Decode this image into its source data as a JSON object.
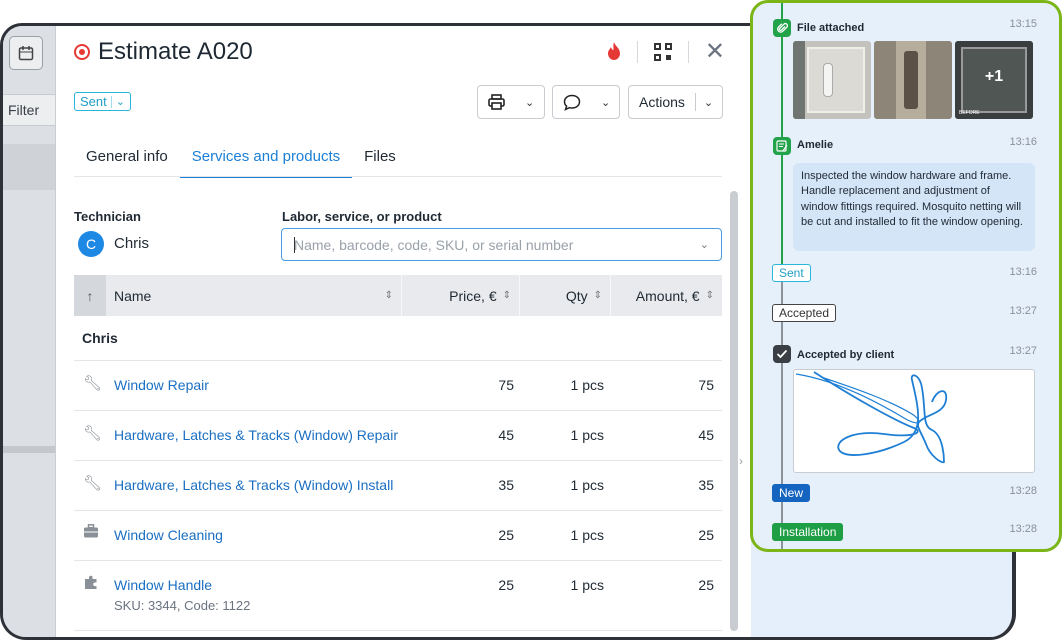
{
  "background": {
    "filter_label": "Filter"
  },
  "modal": {
    "title": "Estimate A020",
    "status": "Sent",
    "actions_label": "Actions",
    "tabs": [
      "General info",
      "Services and products",
      "Files"
    ],
    "technician_label": "Technician",
    "technician_initial": "C",
    "technician_name": "Chris",
    "search_label": "Labor, service, or product",
    "search_placeholder": "Name, barcode, code, SKU, or serial number",
    "columns": {
      "name": "Name",
      "price": "Price, €",
      "qty": "Qty",
      "amount": "Amount, €"
    },
    "group": "Chris",
    "rows": [
      {
        "icon": "wrench-icon",
        "name": "Window Repair",
        "price": "75",
        "qty": "1 pcs",
        "amount": "75",
        "sub": ""
      },
      {
        "icon": "wrench-icon",
        "name": "Hardware, Latches & Tracks (Window) Repair",
        "price": "45",
        "qty": "1 pcs",
        "amount": "45",
        "sub": ""
      },
      {
        "icon": "wrench-icon",
        "name": "Hardware, Latches & Tracks (Window) Install",
        "price": "35",
        "qty": "1 pcs",
        "amount": "35",
        "sub": ""
      },
      {
        "icon": "briefcase-icon",
        "name": "Window Cleaning",
        "price": "25",
        "qty": "1 pcs",
        "amount": "25",
        "sub": ""
      },
      {
        "icon": "puzzle-icon",
        "name": "Window Handle",
        "price": "25",
        "qty": "1 pcs",
        "amount": "25",
        "sub": "SKU: 3344, Code: 1122"
      }
    ]
  },
  "activity": {
    "file_title": "File attached",
    "file_time": "13:15",
    "more_photos": "+1",
    "photo_label": "BEFORE",
    "note_author": "Amelie",
    "note_time": "13:16",
    "note_text": "Inspected the window hardware and frame. Handle replacement and adjustment of window fittings required. Mosquito netting will be cut and installed to fit the window opening.",
    "sent_label": "Sent",
    "sent_time": "13:16",
    "accepted_label": "Accepted",
    "accepted_time": "13:27",
    "client_title": "Accepted by client",
    "client_time": "13:27",
    "new_label": "New",
    "new_time": "13:28",
    "install_label": "Installation",
    "install_time": "13:28"
  },
  "colors": {
    "accent": "#1b7fd6",
    "timeline_green": "#22a34a",
    "panel_border": "#7cb518",
    "tag_new": "#1565c0",
    "tag_install": "#1e9e45"
  }
}
